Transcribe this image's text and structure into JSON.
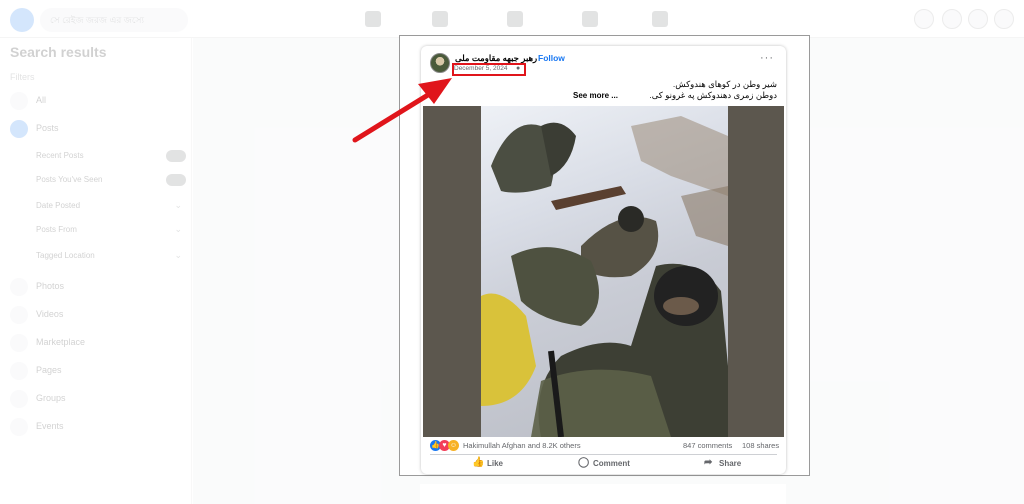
{
  "header": {
    "search_placeholder": "সে রেইজ জরজ এর জস্যে"
  },
  "sidebar": {
    "title": "Search results",
    "filters_label": "Filters",
    "items": [
      {
        "label": "All",
        "active": false
      },
      {
        "label": "Posts",
        "active": true
      },
      {
        "label": "Photos",
        "active": false
      },
      {
        "label": "Videos",
        "active": false
      },
      {
        "label": "Marketplace",
        "active": false
      },
      {
        "label": "Pages",
        "active": false
      },
      {
        "label": "Groups",
        "active": false
      },
      {
        "label": "Events",
        "active": false
      }
    ],
    "sub_filters": [
      {
        "label": "Recent Posts",
        "control": "toggle"
      },
      {
        "label": "Posts You've Seen",
        "control": "toggle"
      },
      {
        "label": "Date Posted",
        "control": "chevron"
      },
      {
        "label": "Posts From",
        "control": "chevron"
      },
      {
        "label": "Tagged Location",
        "control": "chevron"
      }
    ]
  },
  "post": {
    "author": "رهبر جبهه مقاومت ملی",
    "follow_separator": "·",
    "follow": "Follow",
    "more": "···",
    "date": "December 5, 2024",
    "caption_line1": "شیر وطن در کوهای هندوکش.",
    "caption_line2": "دوطن زمری دهندوکش په غرونو کی.",
    "see_more": "See more ...",
    "reactions_text": "Hakimullah Afghan and 8.2K others",
    "comments": "847 comments",
    "shares": "108 shares",
    "actions": {
      "like": "Like",
      "comment": "Comment",
      "share": "Share"
    }
  },
  "colors": {
    "accent": "#1877f2",
    "highlight": "#e0151b",
    "love": "#f33e58",
    "care": "#f7b125"
  },
  "icons": [
    "facebook-logo",
    "search-icon",
    "globe-icon",
    "like-icon",
    "comment-icon",
    "share-icon",
    "red-arrow"
  ]
}
